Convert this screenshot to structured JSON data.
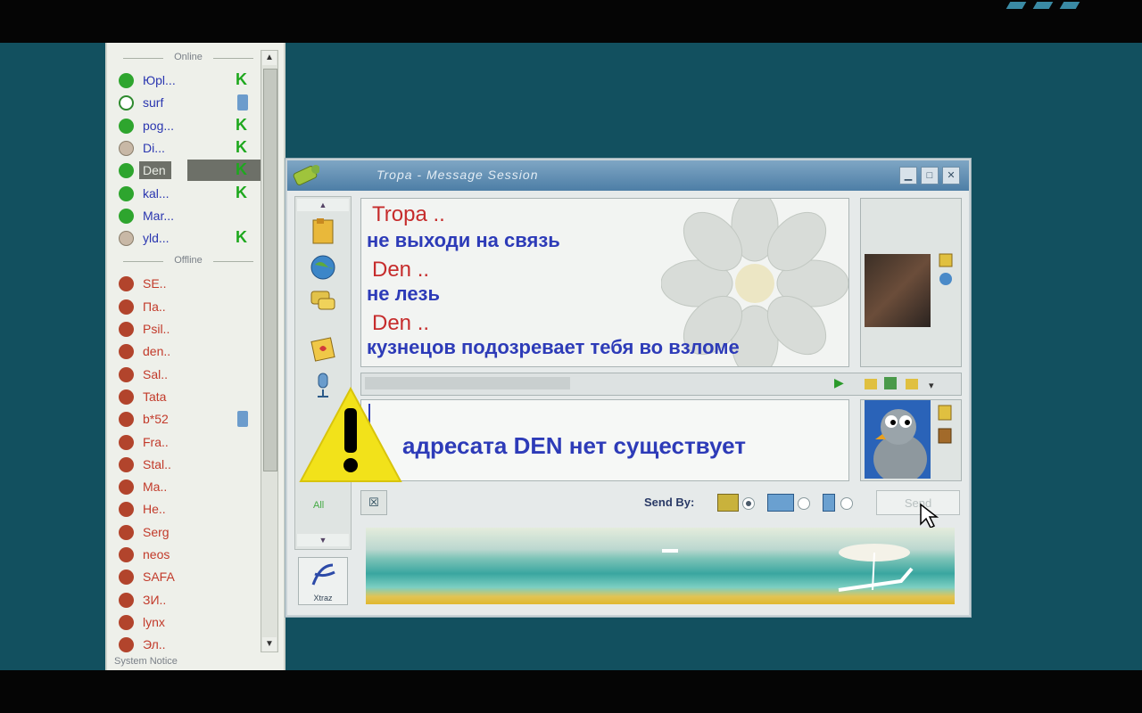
{
  "contacts": {
    "online_header": "Online",
    "offline_header": "Offline",
    "online": [
      {
        "name": "Юрl...",
        "status": "online",
        "extra": "k"
      },
      {
        "name": "surf",
        "status": "half",
        "extra": "phone"
      },
      {
        "name": "pog...",
        "status": "online",
        "extra": "k"
      },
      {
        "name": "Di...",
        "status": "away",
        "extra": "k"
      },
      {
        "name": "Den",
        "status": "online",
        "extra": "k",
        "selected": true
      },
      {
        "name": "kal...",
        "status": "online",
        "extra": "k"
      },
      {
        "name": "Mar...",
        "status": "online",
        "extra": ""
      },
      {
        "name": "yld...",
        "status": "away",
        "extra": "k"
      }
    ],
    "offline": [
      {
        "name": "SE..",
        "extra": ""
      },
      {
        "name": "Па..",
        "extra": ""
      },
      {
        "name": "Psil..",
        "extra": ""
      },
      {
        "name": "den..",
        "extra": ""
      },
      {
        "name": "Sal..",
        "extra": ""
      },
      {
        "name": "Tata",
        "extra": ""
      },
      {
        "name": "b*52",
        "extra": "phone"
      },
      {
        "name": "Fra..",
        "extra": ""
      },
      {
        "name": "Stal..",
        "extra": ""
      },
      {
        "name": "Ma..",
        "extra": ""
      },
      {
        "name": "Не..",
        "extra": ""
      },
      {
        "name": "Serg",
        "extra": ""
      },
      {
        "name": "neos",
        "extra": ""
      },
      {
        "name": "SAFA",
        "extra": ""
      },
      {
        "name": "ЗИ..",
        "extra": ""
      },
      {
        "name": "lynx",
        "extra": ""
      },
      {
        "name": "Эл..",
        "extra": ""
      }
    ],
    "system_notice": "System Notice"
  },
  "window": {
    "title": "Tropa  - Message Session",
    "history": [
      {
        "name": "Tropa ..",
        "text": "не выходи на связь"
      },
      {
        "name": "Den ..",
        "text": "не лезь"
      },
      {
        "name": "Den ..",
        "text": "кузнецов подозревает тебя во взломе"
      }
    ],
    "input_text": "адресата DEN нет существует",
    "send_by_label": "Send By:",
    "send_button": "Send",
    "all_label": "All",
    "xtraz_label": "Xtraz"
  },
  "colors": {
    "background": "#12505f",
    "sender_name": "#c62c2c",
    "message_text": "#2d3bb8",
    "online_dot": "#2ea52e",
    "offline_dot": "#b2442c",
    "warning_yellow": "#f2e21a"
  }
}
